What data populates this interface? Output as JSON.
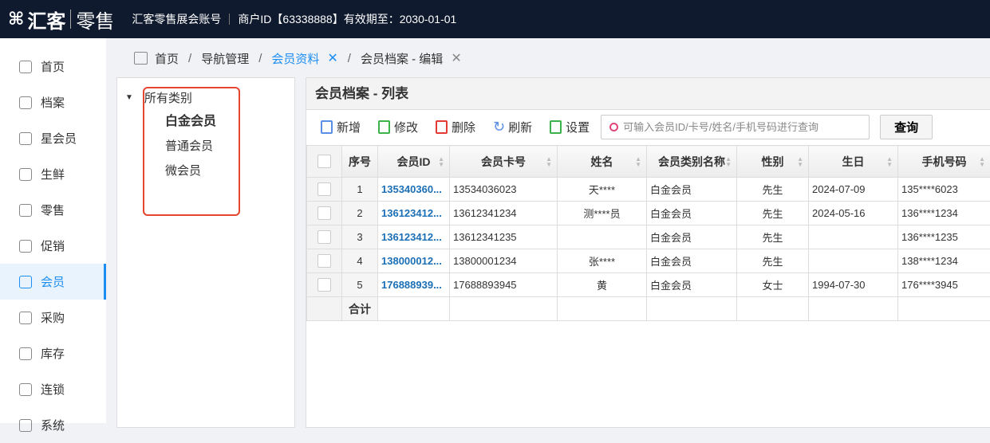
{
  "header": {
    "logo_brand": "汇客",
    "logo_product": "零售",
    "account": "汇客零售展会账号",
    "merchant": "商户ID【63338888】有效期至：2030-01-01"
  },
  "sidebar": {
    "items": [
      {
        "label": "首页"
      },
      {
        "label": "档案"
      },
      {
        "label": "星会员"
      },
      {
        "label": "生鲜"
      },
      {
        "label": "零售"
      },
      {
        "label": "促销"
      },
      {
        "label": "会员",
        "active": true
      },
      {
        "label": "采购"
      },
      {
        "label": "库存"
      },
      {
        "label": "连锁"
      },
      {
        "label": "系统"
      }
    ]
  },
  "breadcrumb": {
    "items": [
      "首页",
      "导航管理",
      "会员资料",
      "会员档案 - 编辑"
    ],
    "close": "✕"
  },
  "tree": {
    "root": "所有类别",
    "children": [
      "白金会员",
      "普通会员",
      "微会员"
    ]
  },
  "panel": {
    "title": "会员档案 - 列表"
  },
  "toolbar": {
    "add": "新增",
    "edit": "修改",
    "delete": "删除",
    "refresh": "刷新",
    "settings": "设置",
    "search_placeholder": "可输入会员ID/卡号/姓名/手机号码进行查询",
    "query": "查询"
  },
  "table": {
    "headers": [
      "序号",
      "会员ID",
      "会员卡号",
      "姓名",
      "会员类别名称",
      "性别",
      "生日",
      "手机号码"
    ],
    "rows": [
      [
        "1",
        "135340360...",
        "13534036023",
        "天****",
        "白金会员",
        "先生",
        "2024-07-09",
        "135****6023"
      ],
      [
        "2",
        "136123412...",
        "13612341234",
        "测****员",
        "白金会员",
        "先生",
        "2024-05-16",
        "136****1234"
      ],
      [
        "3",
        "136123412...",
        "13612341235",
        "",
        "白金会员",
        "先生",
        "",
        "136****1235"
      ],
      [
        "4",
        "138000012...",
        "13800001234",
        "张****",
        "白金会员",
        "先生",
        "",
        "138****1234"
      ],
      [
        "5",
        "176888939...",
        "17688893945",
        "黄",
        "白金会员",
        "女士",
        "1994-07-30",
        "176****3945"
      ]
    ],
    "total_label": "合计"
  },
  "colors": {
    "header_bg": "#0f1a2e",
    "accent": "#1c8ef2",
    "highlight_box": "#e6452f",
    "id_link": "#1b6fb5"
  }
}
